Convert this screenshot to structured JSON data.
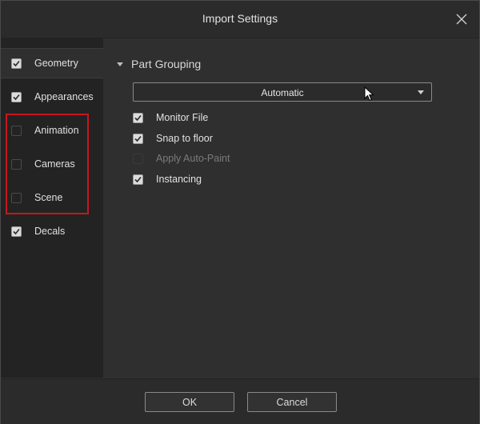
{
  "dialog": {
    "title": "Import Settings",
    "close_icon": "close-icon"
  },
  "sidebar": {
    "items": [
      {
        "label": "Geometry",
        "checked": true,
        "active": true
      },
      {
        "label": "Appearances",
        "checked": true
      },
      {
        "label": "Animation",
        "checked": false
      },
      {
        "label": "Cameras",
        "checked": false
      },
      {
        "label": "Scene",
        "checked": false
      },
      {
        "label": "Decals",
        "checked": true
      }
    ],
    "highlight_color": "#c8161d"
  },
  "main": {
    "section_title": "Part Grouping",
    "dropdown": {
      "selected": "Automatic"
    },
    "options": [
      {
        "label": "Monitor File",
        "checked": true,
        "enabled": true
      },
      {
        "label": "Snap to floor",
        "checked": true,
        "enabled": true
      },
      {
        "label": "Apply Auto-Paint",
        "checked": false,
        "enabled": false
      },
      {
        "label": "Instancing",
        "checked": true,
        "enabled": true
      }
    ]
  },
  "footer": {
    "ok_label": "OK",
    "cancel_label": "Cancel"
  }
}
